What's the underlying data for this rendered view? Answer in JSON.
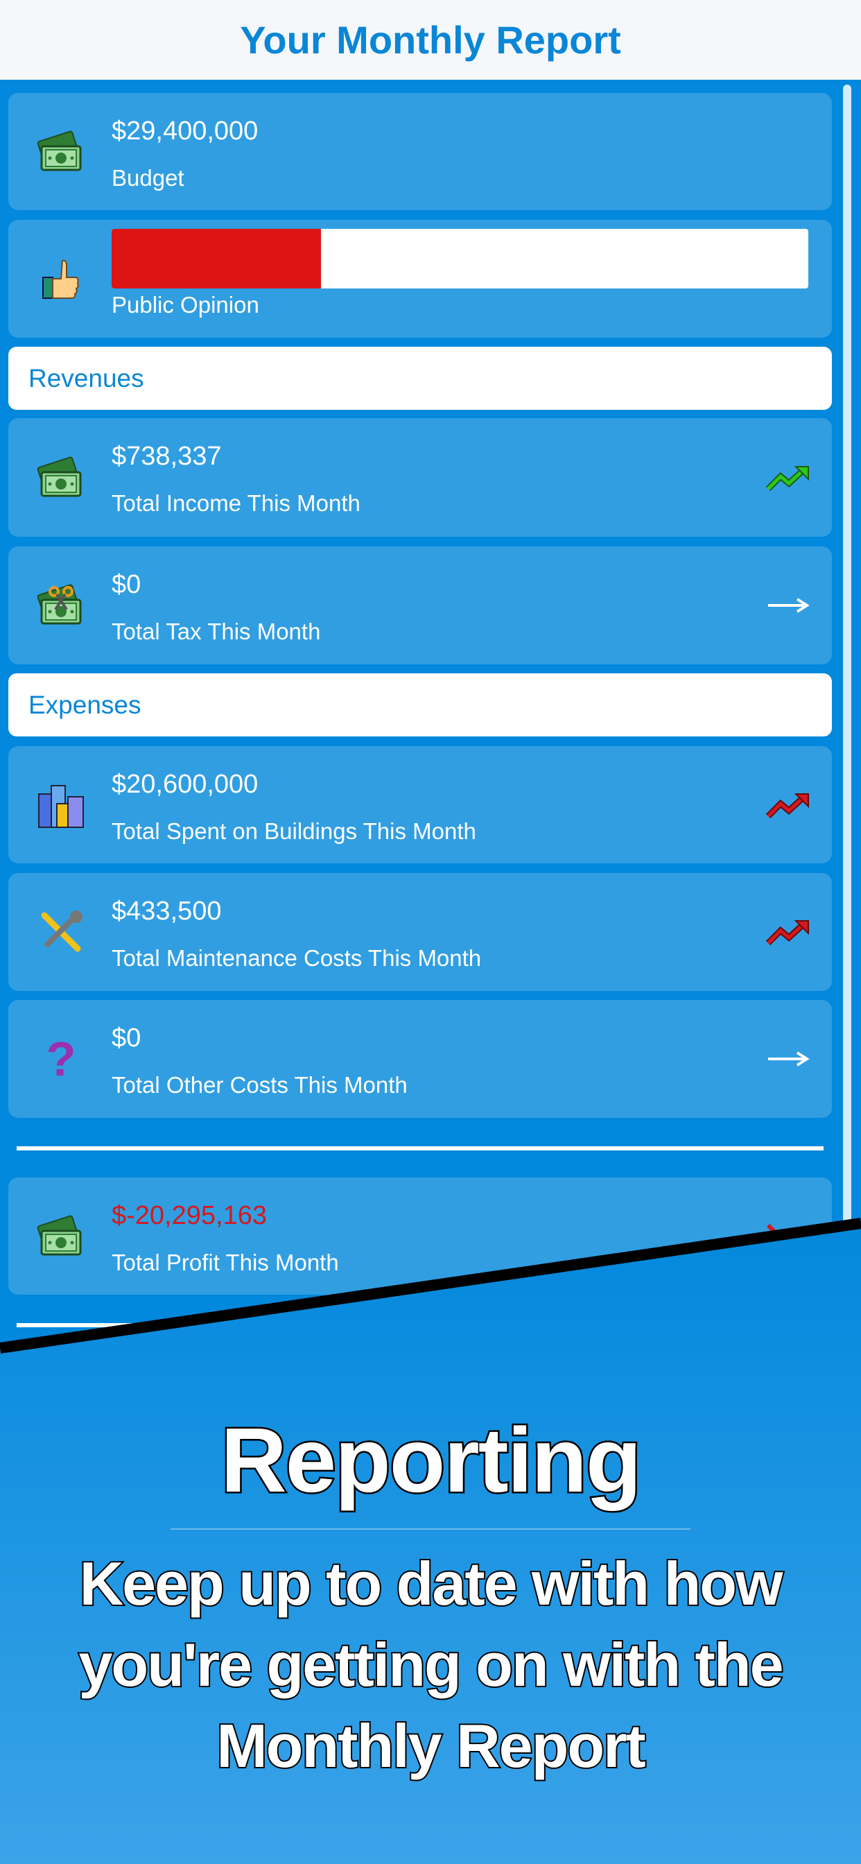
{
  "header": {
    "title": "Your Monthly Report"
  },
  "budget": {
    "value": "$29,400,000",
    "label": "Budget",
    "icon": "money-icon"
  },
  "opinion": {
    "label": "Public Opinion",
    "level_percent": 30,
    "bar_color": "#dc1414",
    "icon": "thumbs-up-icon"
  },
  "revenues": {
    "title": "Revenues",
    "items": [
      {
        "value": "$738,337",
        "label": "Total Income This Month",
        "icon": "money-icon",
        "trend": "up-green"
      },
      {
        "value": "$0",
        "label": "Total Tax This Month",
        "icon": "tax-money-icon",
        "trend": "flat"
      }
    ]
  },
  "expenses": {
    "title": "Expenses",
    "items": [
      {
        "value": "$20,600,000",
        "label": "Total Spent on Buildings This Month",
        "icon": "buildings-icon",
        "trend": "up-red"
      },
      {
        "value": "$433,500",
        "label": "Total Maintenance Costs This Month",
        "icon": "tools-icon",
        "trend": "up-red"
      },
      {
        "value": "$0",
        "label": "Total Other Costs This Month",
        "icon": "question-icon",
        "trend": "flat"
      }
    ]
  },
  "profit": {
    "value": "$-20,295,163",
    "label": "Total Profit This Month",
    "value_color": "#d4191f",
    "icon": "money-icon",
    "trend": "down-red"
  },
  "promo": {
    "headline": "Reporting",
    "subtitle": "Keep up to date with how you're getting on with the Monthly Report"
  },
  "colors": {
    "accent": "#0a86d6",
    "card": "#319ee2",
    "background": "#0288dc",
    "up_green": "#2ec81e",
    "up_red": "#d4191f"
  }
}
